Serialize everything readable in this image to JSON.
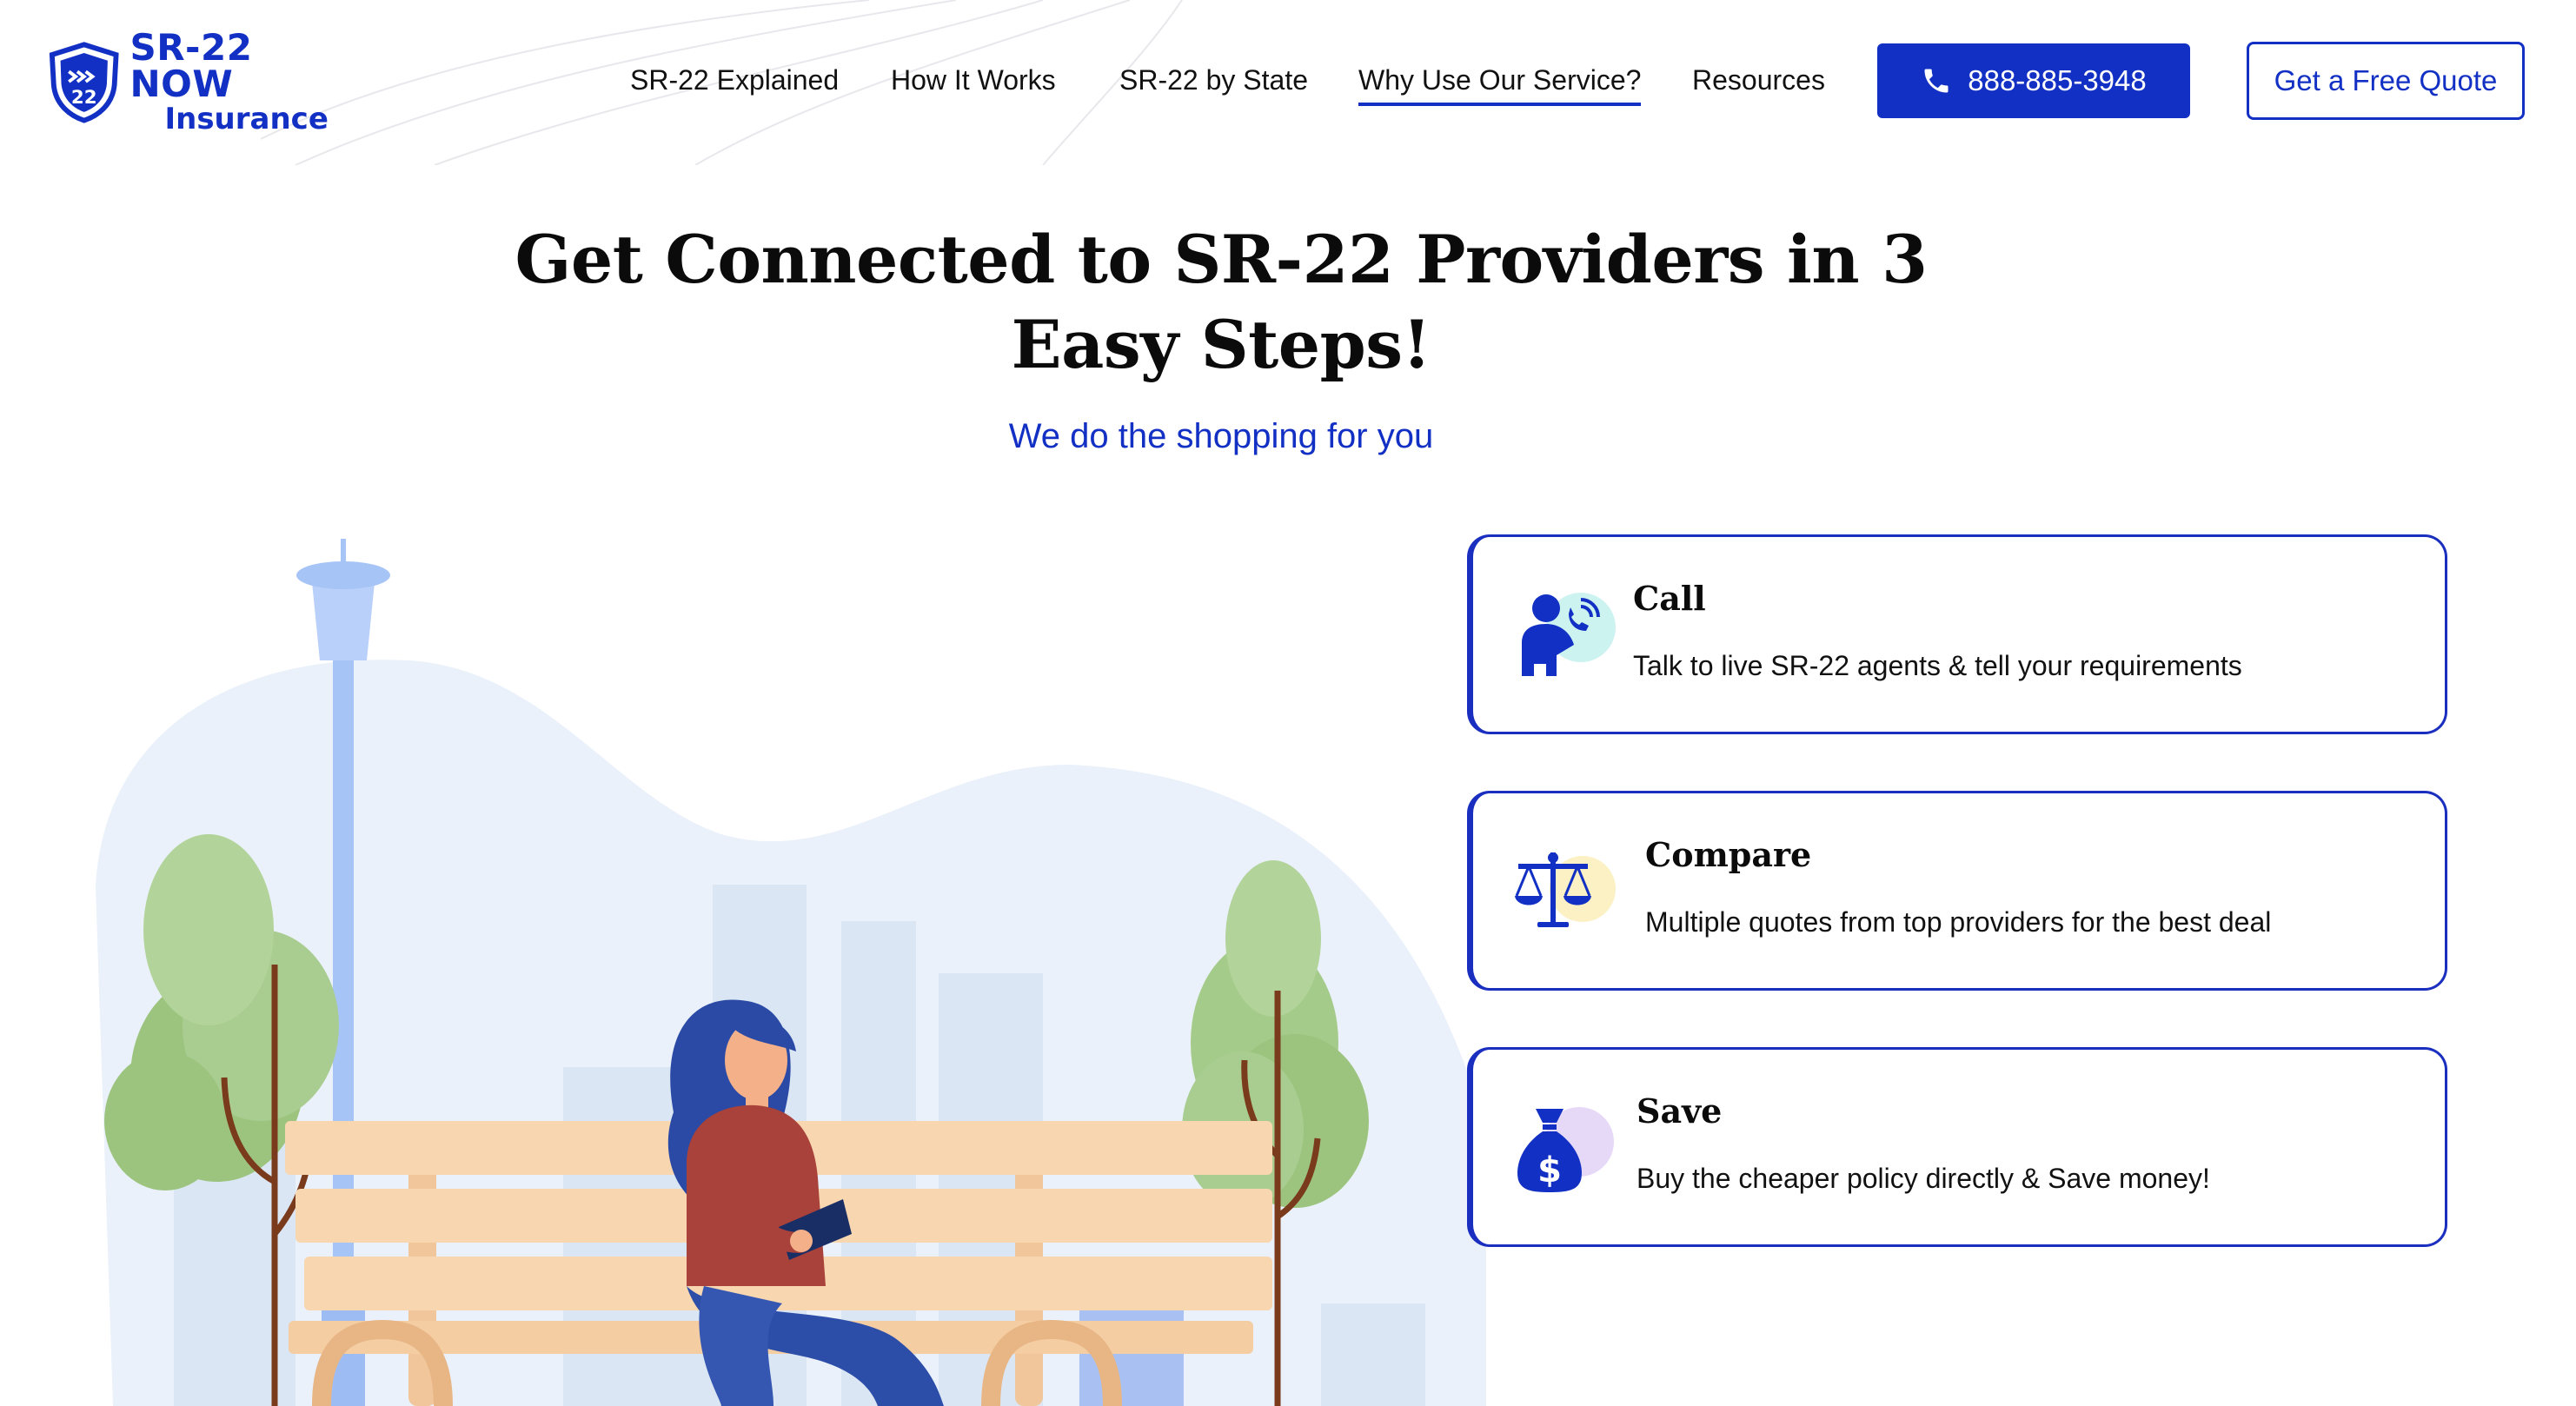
{
  "logo": {
    "main_text": "SR-22 NOW",
    "sub_text": "Insurance",
    "shield_text": "22"
  },
  "nav": {
    "items": [
      {
        "label": "SR-22 Explained"
      },
      {
        "label": "How It Works"
      },
      {
        "label": "SR-22 by State"
      },
      {
        "label": "Why Use Our Service?",
        "active": true
      },
      {
        "label": "Resources"
      }
    ],
    "phone_label": "888-885-3948",
    "quote_label": "Get a Free Quote"
  },
  "hero": {
    "title": "Get Connected to SR-22 Providers in 3 Easy Steps!",
    "subtitle": "We do the shopping for you"
  },
  "steps": [
    {
      "title": "Call",
      "description": "Talk to live SR-22 agents & tell your requirements",
      "icon": "phone-agent-icon",
      "accent": "#cdf3f0"
    },
    {
      "title": "Compare",
      "description": "Multiple quotes from top providers for the best deal",
      "icon": "scales-icon",
      "accent": "#fbf1c4"
    },
    {
      "title": "Save",
      "description": "Buy the cheaper policy directly & Save money!",
      "icon": "money-bag-icon",
      "accent": "#e6d8f7"
    }
  ],
  "colors": {
    "brand": "#1230c4",
    "card_border": "#1a2fbf",
    "text": "#111111"
  }
}
